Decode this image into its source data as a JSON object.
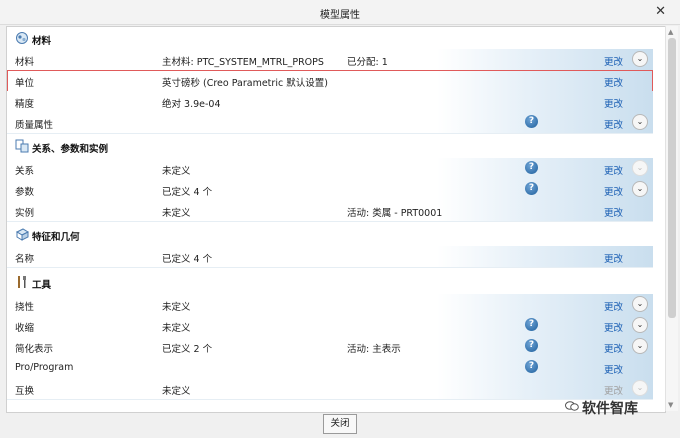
{
  "window": {
    "title": "模型属性",
    "close_label": "✕"
  },
  "sections": {
    "materials": {
      "title": "材料",
      "icon": "materials-icon"
    },
    "relations": {
      "title": "关系、参数和实例",
      "icon": "relations-icon"
    },
    "features": {
      "title": "特征和几何",
      "icon": "features-icon"
    },
    "tools": {
      "title": "工具",
      "icon": "tools-icon"
    }
  },
  "rows": {
    "material": {
      "label": "材料",
      "value": "主材料: PTC_SYSTEM_MTRL_PROPS",
      "extra": "已分配: 1",
      "action": "更改"
    },
    "units": {
      "label": "单位",
      "value": "英寸磅秒 (Creo Parametric 默认设置)",
      "action": "更改"
    },
    "accuracy": {
      "label": "精度",
      "value": "绝对 3.9e-04",
      "action": "更改"
    },
    "mass": {
      "label": "质量属性",
      "action": "更改"
    },
    "relations": {
      "label": "关系",
      "value": "未定义",
      "action": "更改"
    },
    "parameters": {
      "label": "参数",
      "value": "已定义 4 个",
      "action": "更改"
    },
    "instances": {
      "label": "实例",
      "value": "未定义",
      "extra": "活动: 类属 - PRT0001",
      "action": "更改"
    },
    "names": {
      "label": "名称",
      "value": "已定义 4 个",
      "action": "更改"
    },
    "flex": {
      "label": "挠性",
      "value": "未定义",
      "action": "更改"
    },
    "shrink": {
      "label": "收缩",
      "value": "未定义",
      "action": "更改"
    },
    "simplified": {
      "label": "简化表示",
      "value": "已定义 2 个",
      "extra": "活动: 主表示",
      "action": "更改"
    },
    "program": {
      "label": "Pro/Program",
      "action": "更改"
    },
    "interchange": {
      "label": "互换",
      "value": "未定义",
      "action": "更改"
    }
  },
  "help_label": "?",
  "expand_label": "⌄",
  "footer": {
    "close_label": "关闭"
  },
  "watermark": {
    "text": "软件智库"
  },
  "colors": {
    "link": "#1a5fb4",
    "highlight": "#e05a5a",
    "help": "#1e5f9c"
  }
}
